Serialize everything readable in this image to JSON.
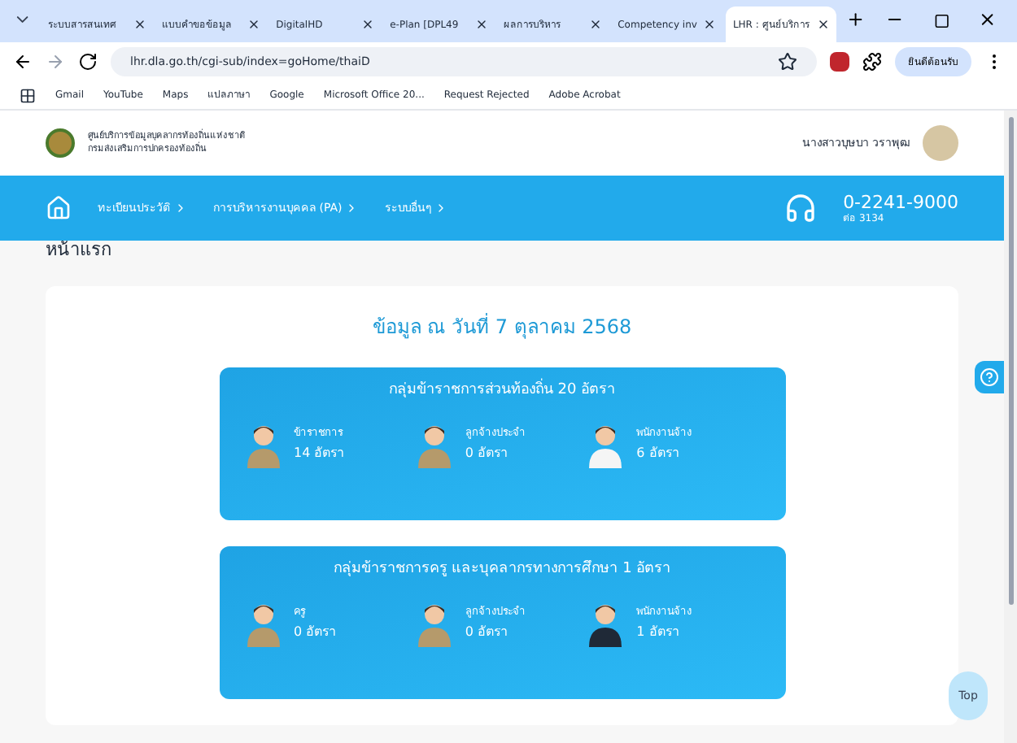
{
  "browser": {
    "tabs": [
      {
        "title": "ระบบสารสนเทศ",
        "selected": false
      },
      {
        "title": "แบบคำขอข้อมูล",
        "selected": false
      },
      {
        "title": "DigitalHD",
        "selected": false
      },
      {
        "title": "e-Plan [DPL49",
        "selected": false
      },
      {
        "title": "ผลการบริหาร",
        "selected": false
      },
      {
        "title": "Competency inv",
        "selected": false
      },
      {
        "title": "LHR : ศูนย์บริการ",
        "selected": true
      }
    ],
    "address": "lhr.dla.go.th/cgi-sub/index=goHome/thaiD",
    "profile": "ยินดีต้อนรับ",
    "bookmarks": [
      "Gmail",
      "YouTube",
      "Maps",
      "แปลภาษา",
      "Google",
      "Microsoft Office 20...",
      "Request Rejected",
      "Adobe Acrobat"
    ]
  },
  "site": {
    "org_name": "ศูนย์บริการข้อมูลบุคลากรท้องถิ่นแห่งชาติ",
    "org_sub": "กรมส่งเสริมการปกครองท้องถิ่น",
    "user_name": "นางสาวบุษบา วราพุฒ",
    "nav": [
      "ทะเบียนประวัติ",
      "การบริหารงานบุคคล (PA)",
      "ระบบอื่นๆ"
    ],
    "phone": "0-2241-9000",
    "phone_ext": "ต่อ 3134"
  },
  "page_title": "หน้าแรก",
  "date_heading": "ข้อมูล ณ วันที่ 7 ตุลาคม 2568",
  "groups": [
    {
      "title": "กลุ่มข้าราชการส่วนท้องถิ่น 20 อัตรา",
      "members": [
        {
          "label": "ข้าราชการ",
          "count": "14 อัตรา",
          "kind": "uniform"
        },
        {
          "label": "ลูกจ้างประจำ",
          "count": "0 อัตรา",
          "kind": "uniform"
        },
        {
          "label": "พนักงานจ้าง",
          "count": "6 อัตรา",
          "kind": "white"
        }
      ]
    },
    {
      "title": "กลุ่มข้าราชการครู และบุคลากรทางการศึกษา 1 อัตรา",
      "members": [
        {
          "label": "ครู",
          "count": "0 อัตรา",
          "kind": "uniform"
        },
        {
          "label": "ลูกจ้างประจำ",
          "count": "0 อัตรา",
          "kind": "uniform"
        },
        {
          "label": "พนักงานจ้าง",
          "count": "1 อัตรา",
          "kind": "dark"
        }
      ]
    }
  ],
  "top_button": "Top"
}
